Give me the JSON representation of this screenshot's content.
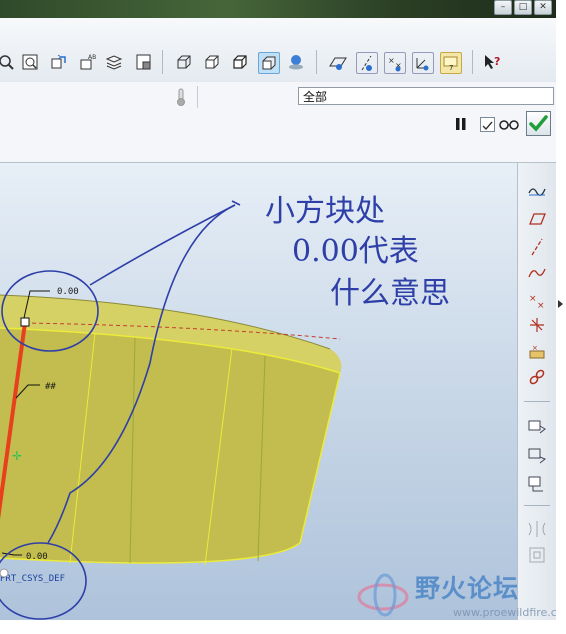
{
  "toolbar": {
    "groups": [
      {
        "icons": [
          "zoom-icon",
          "refit-icon",
          "orient-icon",
          "named-view-icon",
          "layers-icon",
          "model-tree-icon"
        ]
      },
      {
        "icons": [
          "wireframe-icon",
          "hidden-line-icon",
          "no-hidden-icon",
          "shading-icon",
          "spin-center-icon"
        ]
      },
      {
        "icons": [
          "datum-plane-display-icon",
          "datum-axis-display-icon",
          "datum-point-display-icon",
          "coord-sys-display-icon",
          "annotation-display-icon"
        ]
      },
      {
        "icons": [
          "context-help-icon"
        ]
      }
    ]
  },
  "dashboard": {
    "filter_value": "全部",
    "pause_label": "暂停",
    "check_label": "完成"
  },
  "viewport": {
    "dim_top": "0.00",
    "dim_mid": "##",
    "dim_bottom": "0.00",
    "csys_label": "PRT_CSYS_DEF",
    "annotation_line1": "小方块处",
    "annotation_line2": "0.00代表",
    "annotation_line3": "什么意思"
  },
  "watermark": {
    "name": "野火论坛",
    "url": "www.proewildfire.cn"
  },
  "colors": {
    "surface": "#c9c455",
    "edge": "#e6e43a",
    "axis": "#e8401c",
    "ink": "#2e3fa8",
    "accent_check": "#1f9e3a"
  }
}
